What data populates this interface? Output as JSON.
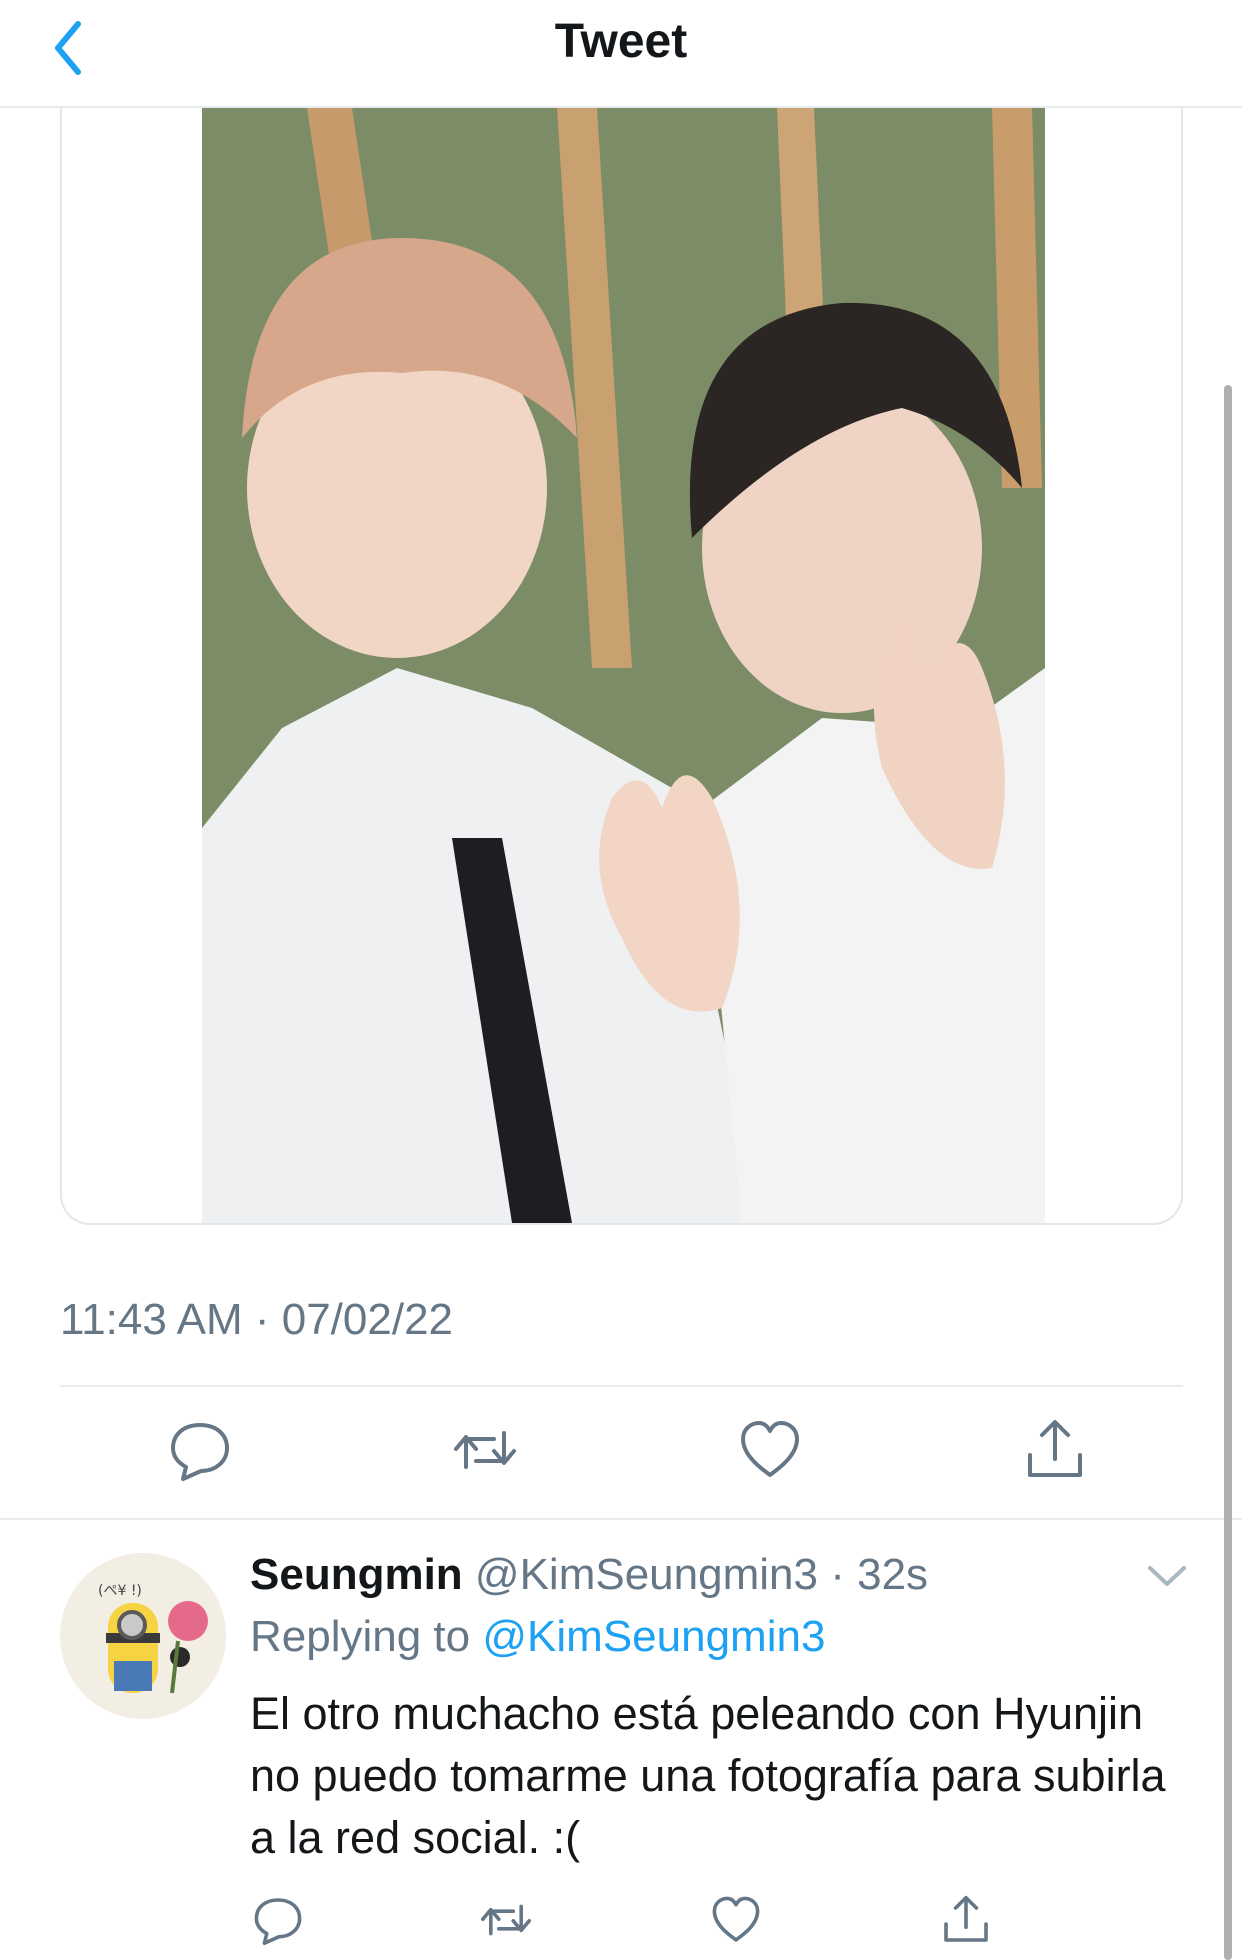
{
  "header": {
    "title": "Tweet"
  },
  "tweet": {
    "timestamp": "11:43 AM · 07/02/22"
  },
  "reply": {
    "name": "Seungmin",
    "handle": "@KimSeungmin3",
    "separator": "·",
    "time": "32s",
    "replying_prefix": "Replying to",
    "replying_to": "@KimSeungmin3",
    "text": "El otro muchacho está peleando con Hyunjin no puedo tomarme una fotografía para subirla a la red social. :("
  },
  "avatar_caption": "(ぺ¥ !)",
  "icons": {
    "back": "chevron-left-icon",
    "reply": "speech-bubble-icon",
    "retweet": "retweet-icon",
    "like": "heart-icon",
    "share": "share-upload-icon",
    "more": "chevron-down-icon"
  },
  "colors": {
    "accent": "#1da1f2",
    "secondary_text": "#657786",
    "primary_text": "#14171a",
    "divider": "#e6ecf0"
  }
}
